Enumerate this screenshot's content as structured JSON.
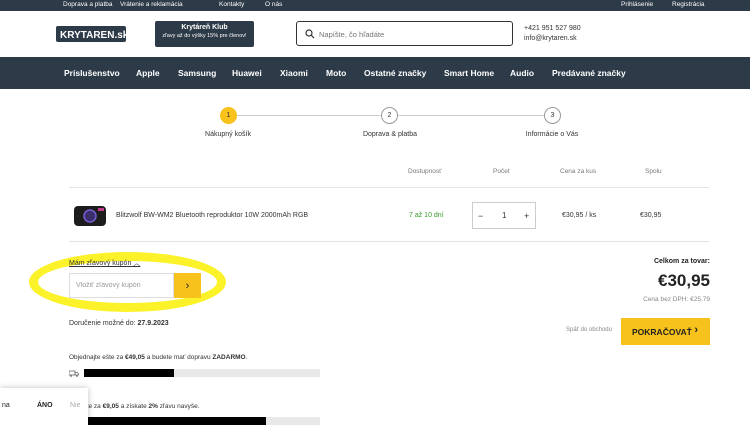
{
  "topbar": {
    "links": [
      "Doprava a platba",
      "Vrátenie a reklamácia",
      "Kontakty",
      "O nás"
    ],
    "account": [
      "Prihlásenie",
      "Registrácia"
    ]
  },
  "header": {
    "logo_text": "KRYTAREN.sk",
    "club_title": "Krytáreň Klub",
    "club_sub": "zľavy až do výšky 15% pre členov!",
    "search_placeholder": "Napíšte, čo hľadáte",
    "phone": "+421 951 527 980",
    "email": "info@krytaren.sk"
  },
  "nav": [
    "Príslušenstvo",
    "Apple",
    "Samsung",
    "Huawei",
    "Xiaomi",
    "Moto",
    "Ostatné značky",
    "Smart Home",
    "Audio",
    "Predávané značky"
  ],
  "steps": [
    {
      "num": "1",
      "label": "Nákupný košík"
    },
    {
      "num": "2",
      "label": "Doprava & platba"
    },
    {
      "num": "3",
      "label": "Informácie o Vás"
    }
  ],
  "table": {
    "headers": {
      "availability": "Dostupnosť",
      "qty": "Počet",
      "unit_price": "Cena za kus",
      "total": "Spolu"
    },
    "item": {
      "name": "Blitzwolf BW-WM2 Bluetooth reproduktor 10W 2000mAh RGB",
      "availability": "7 až 10 dní",
      "qty": "1",
      "unit_price": "€30,95 / ks",
      "total": "€30,95"
    }
  },
  "coupon": {
    "link": "Mám zľavový kupón",
    "placeholder": "Vložiť zľavový kupón",
    "button": "›"
  },
  "delivery": {
    "label": "Doručenie možné do:",
    "date": "27.9.2023"
  },
  "summary": {
    "label": "Celkom za tovar:",
    "value": "€30,95",
    "vat_label": "Cena bez DPH:",
    "vat_value": "€25,79"
  },
  "actions": {
    "back": "Späť do obchodu",
    "continue": "POKRAČOVAŤ",
    "continue_icon": "›"
  },
  "promos": [
    {
      "text_pre": "Objednajte ešte za ",
      "amount": "€49,05",
      "text_mid": " a budete mať dopravu ",
      "bold_end": "ZADARMO",
      "text_end": ".",
      "progress": 0.38
    },
    {
      "text_pre": "pte ešte za ",
      "amount": "€9,05",
      "text_mid": " a získate ",
      "bold_end": "2%",
      "text_end": " zľavu navyše.",
      "progress": 0.77
    }
  ],
  "cookie": {
    "left": "na",
    "yes": "ÁNO",
    "no": "Nie"
  },
  "colors": {
    "accent": "#f7c21b",
    "nav": "#2d3a48",
    "highlight": "#fbf22a",
    "availability": "#3a9a2a"
  }
}
